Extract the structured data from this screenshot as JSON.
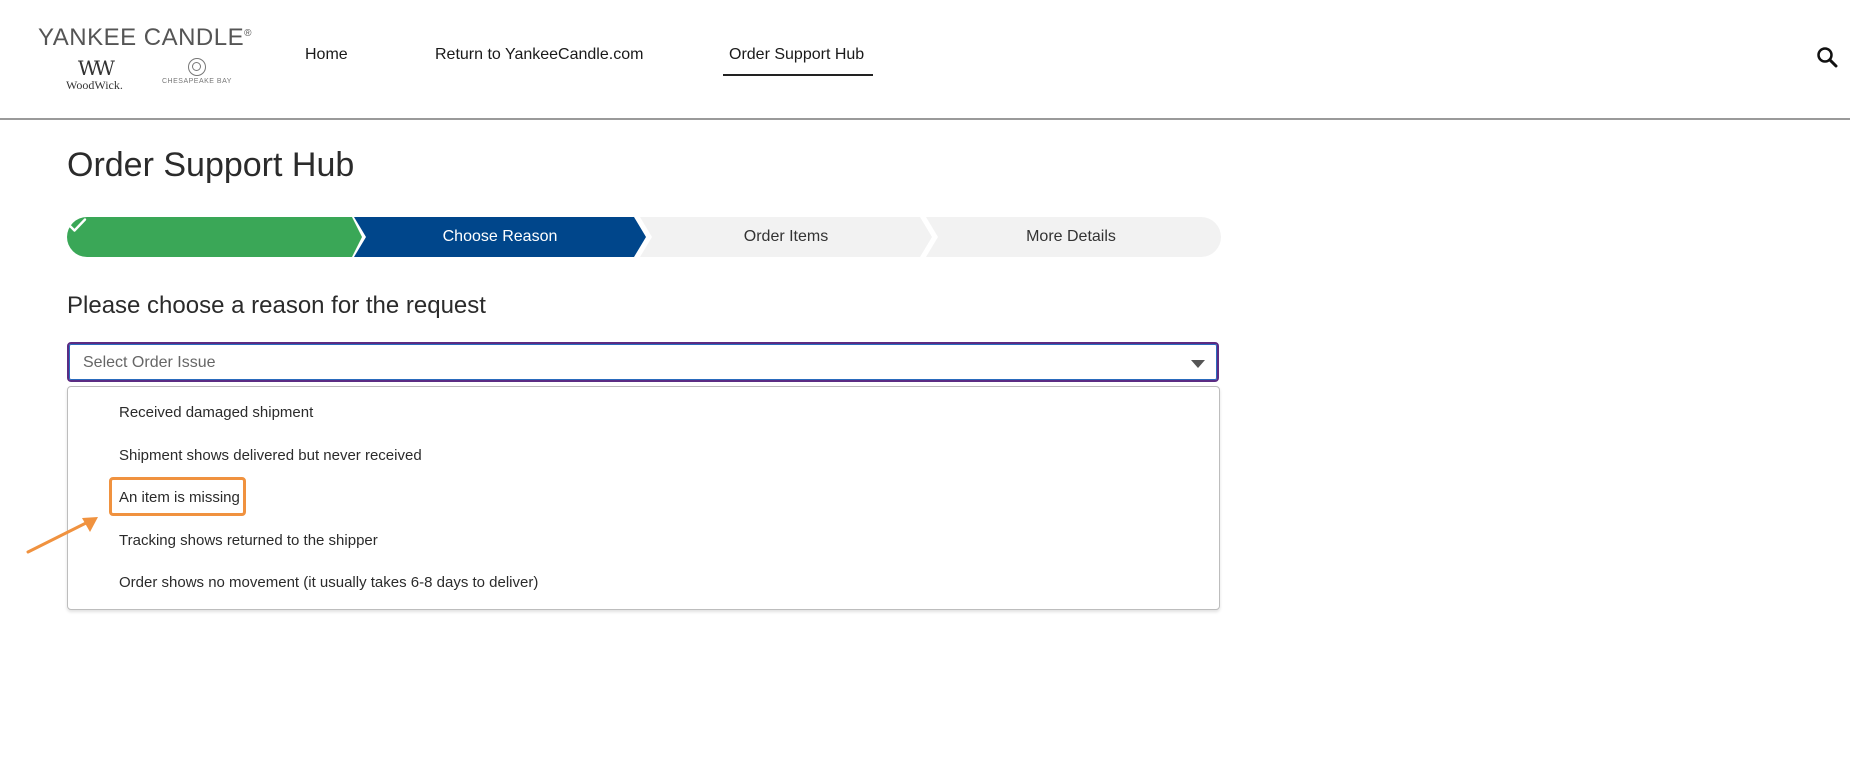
{
  "header": {
    "logo": {
      "brand": "YANKEE CANDLE",
      "reg": "®",
      "sub1_mark": "WW",
      "sub1": "WoodWick.",
      "sub2": "CHESAPEAKE BAY"
    },
    "nav": {
      "home": "Home",
      "return": "Return to YankeeCandle.com",
      "hub": "Order Support Hub"
    },
    "search_icon": "search-icon"
  },
  "main": {
    "title": "Order Support Hub",
    "steps": [
      {
        "label": "",
        "state": "complete",
        "color": "#3aa757"
      },
      {
        "label": "Choose Reason",
        "state": "active",
        "color": "#00468b"
      },
      {
        "label": "Order Items",
        "state": "upcoming",
        "color": "#f2f2f2"
      },
      {
        "label": "More Details",
        "state": "upcoming",
        "color": "#f2f2f2"
      }
    ],
    "reason_heading": "Please choose a reason for the request",
    "select": {
      "placeholder": "Select Order Issue"
    },
    "options": [
      "Received damaged shipment",
      "Shipment shows delivered but never received",
      "An item is missing",
      "Tracking shows returned to the shipper",
      "Order shows no movement (it usually takes 6-8 days to deliver)"
    ],
    "highlighted_option": "An item is missing",
    "annotation_color": "#f0923f"
  }
}
